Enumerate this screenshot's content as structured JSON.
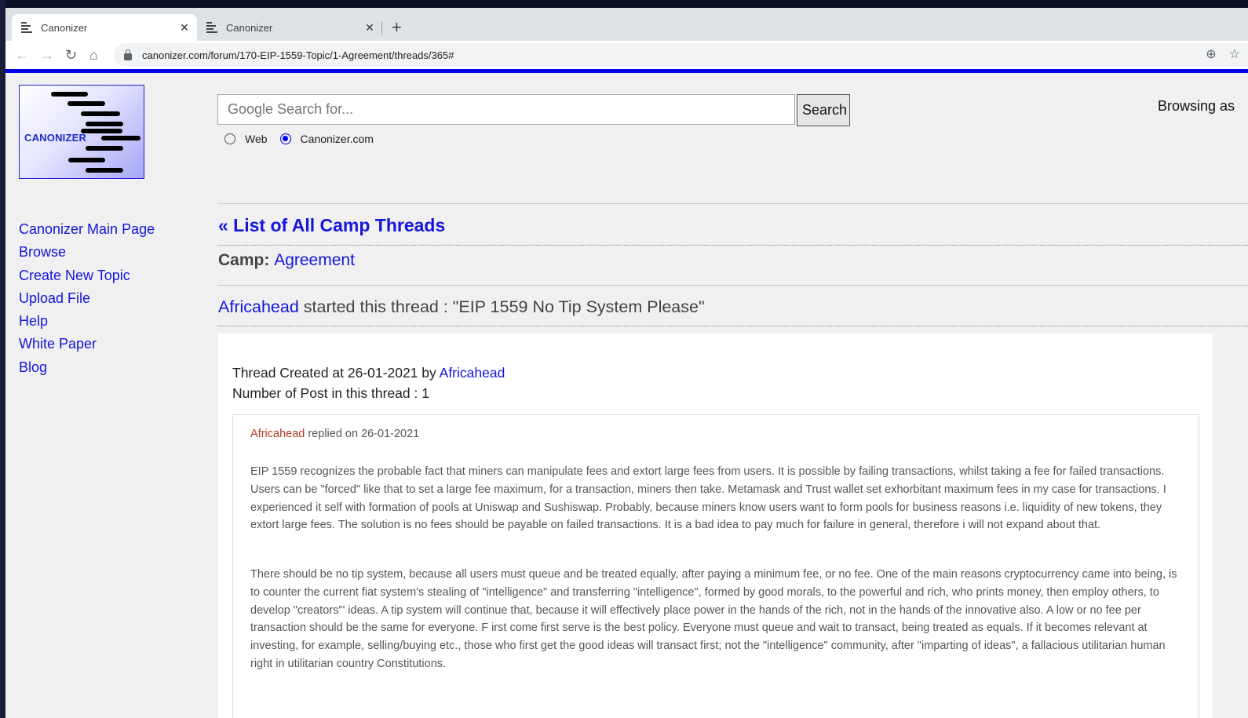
{
  "browser": {
    "tabs": [
      {
        "title": "Canonizer",
        "active": true
      },
      {
        "title": "Canonizer",
        "active": false
      }
    ],
    "url": "canonizer.com/forum/170-EIP-1559-Topic/1-Agreement/threads/365#"
  },
  "logo": {
    "text": "CANONIZER"
  },
  "search": {
    "placeholder": "Google Search for...",
    "button_label": "Search",
    "options": [
      {
        "label": "Web",
        "selected": false
      },
      {
        "label": "Canonizer.com",
        "selected": true
      }
    ]
  },
  "header": {
    "browsing_as": "Browsing as"
  },
  "sidebar": {
    "items": [
      {
        "label": "Canonizer Main Page"
      },
      {
        "label": "Browse"
      },
      {
        "label": "Create New Topic"
      },
      {
        "label": "Upload File"
      },
      {
        "label": "Help"
      },
      {
        "label": "White Paper"
      },
      {
        "label": "Blog"
      }
    ]
  },
  "main": {
    "back_link": "« List of All Camp Threads",
    "camp_label": "Camp:",
    "camp_name": "Agreement",
    "thread_author": "Africahead",
    "thread_title_text": " started this thread : \"EIP 1559 No Tip System Please\"",
    "created_prefix": "Thread Created at 26-01-2021 by ",
    "created_by": "Africahead",
    "post_count": "Number of Post in this thread : 1",
    "post": {
      "author": "Africahead",
      "replied_text": " replied on 26-01-2021",
      "paragraphs": [
        "EIP 1559 recognizes the probable fact that miners can manipulate fees and extort large fees from users. It is possible by failing transactions, whilst taking a fee for failed transactions. Users can be \"forced\" like that to set a large fee maximum, for a transaction, miners then take. Metamask and Trust wallet set exhorbitant maximum fees in my case for transactions. I experienced it self with formation of pools at Uniswap and Sushiswap. Probably, because miners know users want to form pools for business reasons i.e. liquidity of new tokens, they extort large fees. The solution is no fees should be payable on failed transactions. It is a bad idea to pay much for failure in general, therefore i will not expand about that.",
        "There should be no tip system, because all users must queue and be treated equally, after paying a minimum fee, or no fee. One of the main reasons cryptocurrency came into being, is to counter the current fiat system's stealing of \"intelligence\" and transferring \"intelligence\", formed by good morals, to the powerful and rich, who prints money, then employ others, to develop \"creators'\" ideas. A tip system will continue that, because it will effectively place power in the hands of the rich, not in the hands of the innovative also. A low or no fee per transaction should be the same for everyone. F irst come first serve is the best policy. Everyone must queue and wait to transact, being treated as equals. If it becomes relevant at investing, for example, selling/buying etc., those who first get the good ideas will transact first; not the \"intelligence\" community, after \"imparting of ideas\", a fallacious utilitarian human right in utilitarian country Constitutions."
      ]
    }
  }
}
